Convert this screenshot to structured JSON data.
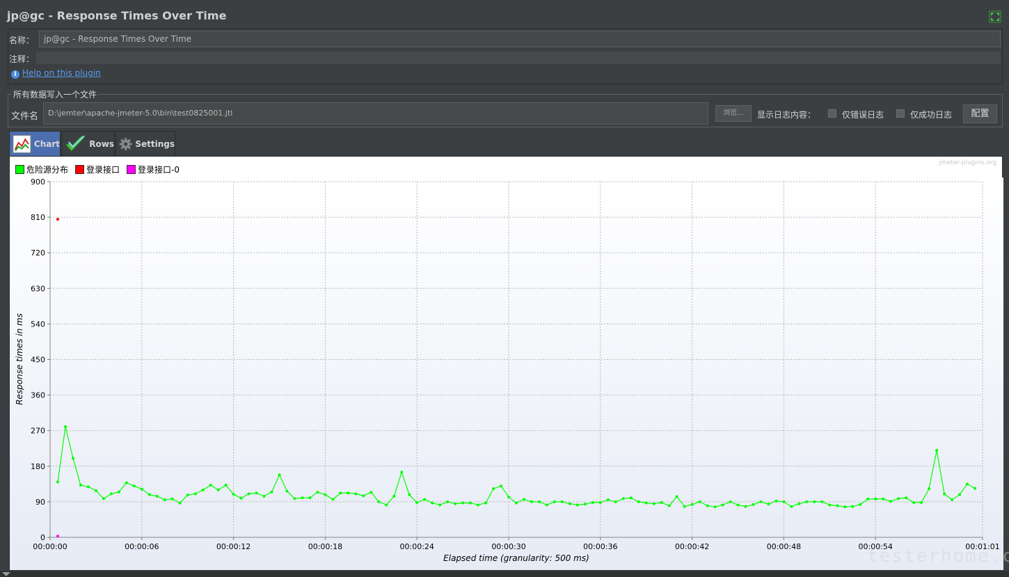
{
  "window": {
    "title": "jp@gc - Response Times Over Time"
  },
  "form": {
    "name_label": "名称：",
    "name_value": "jp@gc - Response Times Over Time",
    "comment_label": "注释：",
    "comment_value": "",
    "help_link": "Help on this plugin"
  },
  "file_section": {
    "legend": "所有数据写入一个文件",
    "filename_label": "文件名",
    "filename_value": "D:\\jemter\\apache-jmeter-5.0\\bin\\test0825001.jtl",
    "browse_label": "浏览...",
    "log_content_label": "显示日志内容：",
    "errors_only_label": "仅错误日志",
    "errors_only_checked": false,
    "success_only_label": "仅成功日志",
    "success_only_checked": false,
    "config_label": "配置"
  },
  "tabs": [
    {
      "label": "Chart",
      "icon": "chart-icon",
      "active": true
    },
    {
      "label": "Rows",
      "icon": "checkmark-icon",
      "active": false
    },
    {
      "label": "Settings",
      "icon": "gear-icon",
      "active": false
    }
  ],
  "watermark_top": "jmeter-plugins.org",
  "site_watermark": "testerhome.com",
  "chart_data": {
    "type": "line",
    "xlabel": "Elapsed time (granularity: 500 ms)",
    "ylabel": "Response times in ms",
    "ylim": [
      0,
      900
    ],
    "y_ticks": [
      "0",
      "90",
      "180",
      "270",
      "360",
      "450",
      "540",
      "630",
      "720",
      "810",
      "900"
    ],
    "x_ticks": [
      "00:00:00",
      "00:00:06",
      "00:00:12",
      "00:00:18",
      "00:00:24",
      "00:00:30",
      "00:00:36",
      "00:00:42",
      "00:00:48",
      "00:00:54",
      "00:01:01"
    ],
    "x_tick_seconds": [
      0,
      6,
      12,
      18,
      24,
      30,
      36,
      42,
      48,
      54,
      61
    ],
    "xlim_seconds": [
      0,
      61
    ],
    "grid": true,
    "legend_position": "top-left",
    "series": [
      {
        "name": "危险源分布",
        "color": "#00ff00",
        "x_start_seconds": 0.5,
        "x_step_seconds": 0.5,
        "values": [
          140,
          280,
          200,
          132,
          128,
          118,
          98,
          110,
          115,
          138,
          130,
          122,
          108,
          104,
          95,
          97,
          87,
          107,
          110,
          120,
          132,
          120,
          132,
          109,
          99,
          110,
          112,
          104,
          115,
          158,
          117,
          98,
          100,
          100,
          114,
          108,
          96,
          112,
          112,
          110,
          105,
          114,
          90,
          82,
          104,
          165,
          108,
          88,
          96,
          87,
          82,
          90,
          85,
          87,
          87,
          82,
          87,
          123,
          130,
          102,
          87,
          96,
          90,
          90,
          82,
          90,
          90,
          85,
          82,
          84,
          88,
          88,
          95,
          90,
          98,
          100,
          90,
          87,
          85,
          88,
          80,
          103,
          78,
          83,
          90,
          80,
          77,
          82,
          90,
          82,
          78,
          83,
          90,
          84,
          92,
          90,
          78,
          85,
          90,
          90,
          90,
          82,
          80,
          77,
          78,
          83,
          97,
          97,
          97,
          91,
          98,
          100,
          88,
          88,
          123,
          220,
          110,
          95,
          108,
          135,
          124
        ]
      },
      {
        "name": "登录接口",
        "color": "#ff0000",
        "points": [
          [
            0.5,
            805
          ]
        ]
      },
      {
        "name": "登录接口-0",
        "color": "#ff00ff",
        "points": [
          [
            0.5,
            3
          ]
        ]
      }
    ]
  }
}
